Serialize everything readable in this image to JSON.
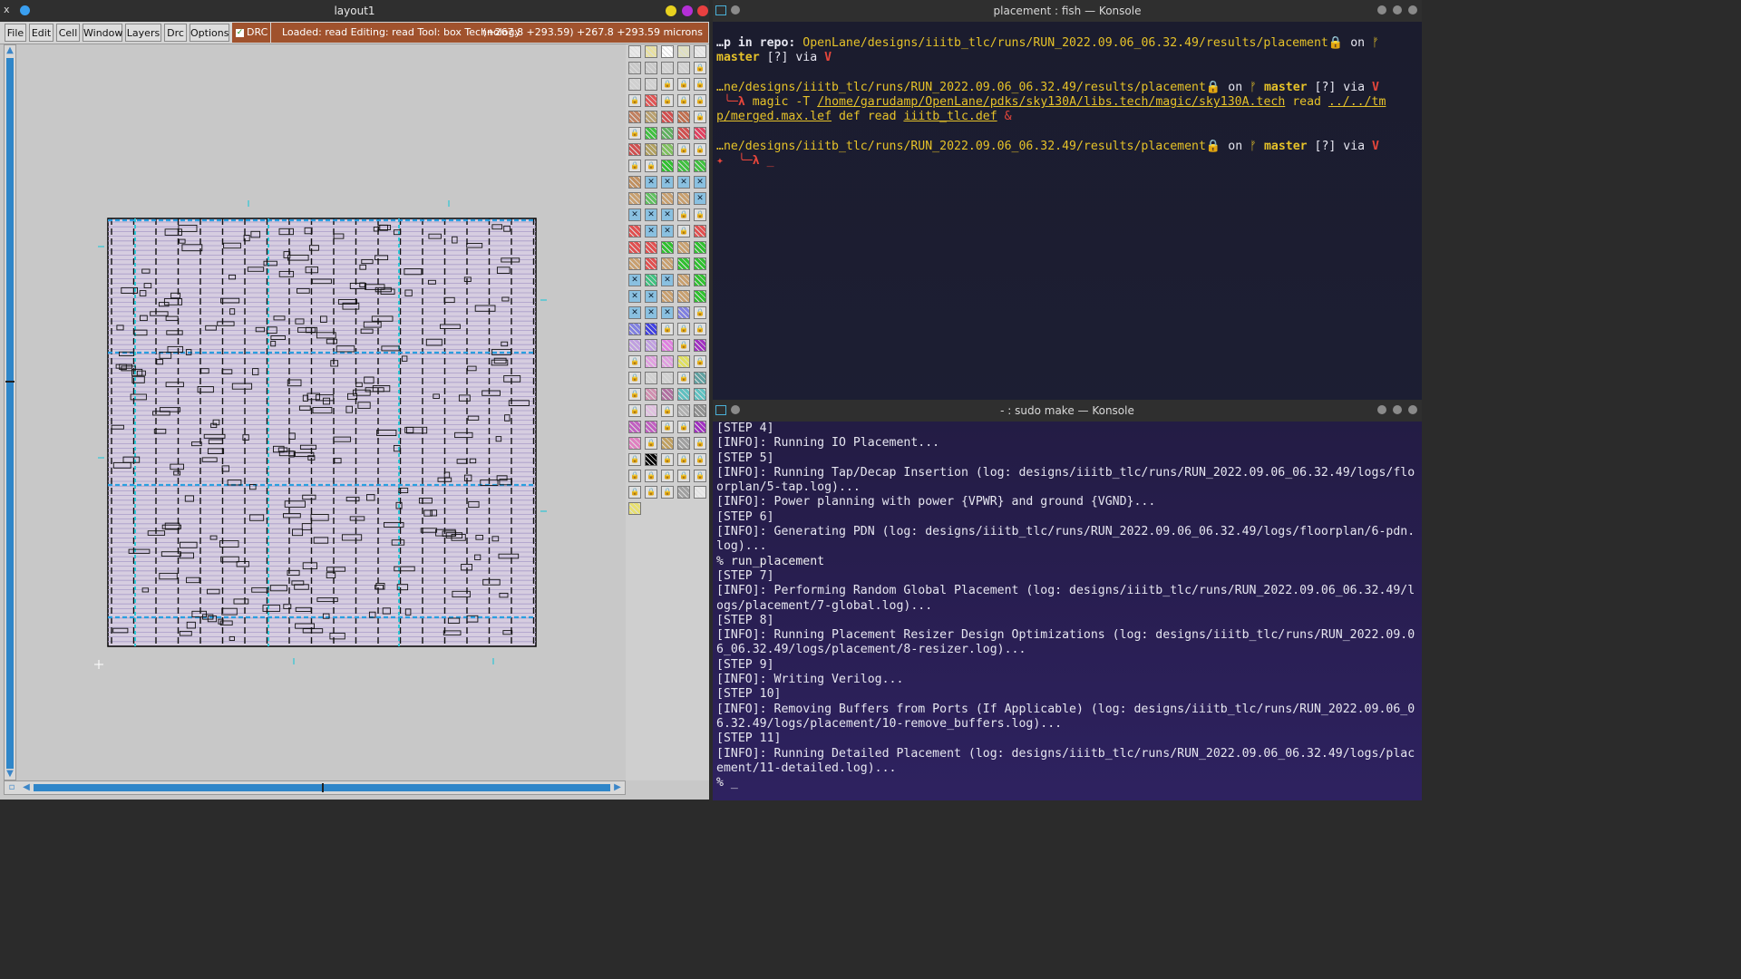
{
  "magic": {
    "title": "layout1",
    "close_glyph": "x",
    "menus": [
      "File",
      "Edit",
      "Cell",
      "Window",
      "Layers",
      "Drc",
      "Options"
    ],
    "drc_label": "DRC",
    "status": "Loaded: read Editing: read Tool: box  Technology: sky130A",
    "coords": "(+267.8 +293.59) +267.8 +293.59 microns",
    "title_dot_colors": [
      "#e8d21f",
      "#b42fd6",
      "#e84040"
    ]
  },
  "konsole_top": {
    "title": "placement : fish — Konsole",
    "lines": [
      [
        {
          "t": "…p in repo: ",
          "c": "w",
          "b": true
        },
        {
          "t": "OpenLane/designs/iiitb_tlc/runs/RUN_2022.09.06_06.32.49/results/placement",
          "c": "y"
        },
        {
          "t": "🔒 on ",
          "c": "w"
        },
        {
          "t": "ᚠ",
          "c": "y"
        }
      ],
      [
        {
          "t": "master",
          "c": "y",
          "b": true
        },
        {
          "t": " [?] via ",
          "c": "w"
        },
        {
          "t": "V",
          "c": "r",
          "b": true
        }
      ],
      [
        {
          "t": "",
          "c": "w"
        }
      ],
      [
        {
          "t": "…ne/designs/iiitb_tlc/runs/RUN_2022.09.06_06.32.49/results/placement",
          "c": "y"
        },
        {
          "t": "🔒 on ",
          "c": "w"
        },
        {
          "t": "ᚠ ",
          "c": "y"
        },
        {
          "t": "master",
          "c": "y",
          "b": true
        },
        {
          "t": " [?] via ",
          "c": "w"
        },
        {
          "t": "V",
          "c": "r",
          "b": true
        }
      ],
      [
        {
          "t": " ╰─λ ",
          "c": "r",
          "b": true
        },
        {
          "t": "magic -T ",
          "c": "y"
        },
        {
          "t": "/home/garudamp/OpenLane/pdks/sky130A/libs.tech/magic/sky130A.tech",
          "c": "y",
          "u": true
        },
        {
          "t": " read ",
          "c": "y"
        },
        {
          "t": "../../tm",
          "c": "y",
          "u": true
        }
      ],
      [
        {
          "t": "p/merged.max.lef",
          "c": "y",
          "u": true
        },
        {
          "t": " def read ",
          "c": "y"
        },
        {
          "t": "iiitb_tlc.def",
          "c": "y",
          "u": true
        },
        {
          "t": " &",
          "c": "r"
        }
      ],
      [
        {
          "t": "",
          "c": "w"
        }
      ],
      [
        {
          "t": "…ne/designs/iiitb_tlc/runs/RUN_2022.09.06_06.32.49/results/placement",
          "c": "y"
        },
        {
          "t": "🔒 on ",
          "c": "w"
        },
        {
          "t": "ᚠ ",
          "c": "y"
        },
        {
          "t": "master",
          "c": "y",
          "b": true
        },
        {
          "t": " [?] via ",
          "c": "w"
        },
        {
          "t": "V",
          "c": "r",
          "b": true
        }
      ],
      [
        {
          "t": "✦  ╰─λ ",
          "c": "r",
          "b": true
        },
        {
          "t": "_",
          "c": "r"
        }
      ]
    ]
  },
  "konsole_bottom": {
    "title": "- : sudo make — Konsole",
    "lines": [
      "[STEP 4]",
      "[INFO]: Running IO Placement...",
      "[STEP 5]",
      "[INFO]: Running Tap/Decap Insertion (log: designs/iiitb_tlc/runs/RUN_2022.09.06_06.32.49/logs/floorplan/5-tap.log)...",
      "[INFO]: Power planning with power {VPWR} and ground {VGND}...",
      "[STEP 6]",
      "[INFO]: Generating PDN (log: designs/iiitb_tlc/runs/RUN_2022.09.06_06.32.49/logs/floorplan/6-pdn.log)...",
      "% run_placement",
      "[STEP 7]",
      "[INFO]: Performing Random Global Placement (log: designs/iiitb_tlc/runs/RUN_2022.09.06_06.32.49/logs/placement/7-global.log)...",
      "[STEP 8]",
      "[INFO]: Running Placement Resizer Design Optimizations (log: designs/iiitb_tlc/runs/RUN_2022.09.06_06.32.49/logs/placement/8-resizer.log)...",
      "[STEP 9]",
      "[INFO]: Writing Verilog...",
      "[STEP 10]",
      "[INFO]: Removing Buffers from Ports (If Applicable) (log: designs/iiitb_tlc/runs/RUN_2022.09.06_06.32.49/logs/placement/10-remove_buffers.log)...",
      "[STEP 11]",
      "[INFO]: Running Detailed Placement (log: designs/iiitb_tlc/runs/RUN_2022.09.06_06.32.49/logs/placement/11-detailed.log)...",
      "% _"
    ]
  },
  "palette_rows": [
    [
      "#e8e8e8",
      "#e8e0a0",
      "#ffffff",
      "#e0e0c0",
      "#e8e8e8"
    ],
    [
      "#c8c8c8",
      "#c8c8c8",
      "#d0d0d0",
      "#d0d0d0",
      "lock"
    ],
    [
      "#d0d0d0",
      "#d0d0d0",
      "lock",
      "lock",
      "lock"
    ],
    [
      "lock",
      "#e05555",
      "lock",
      "lock",
      "lock"
    ],
    [
      "#c08060",
      "#b8a070",
      "#d05050",
      "#c07050",
      "lock"
    ],
    [
      "lock",
      "#40c040",
      "#60b060",
      "#d05050",
      "#e04060"
    ],
    [
      "#d05050",
      "#b0a060",
      "#80c060",
      "lock",
      "lock"
    ],
    [
      "lock",
      "lock",
      "#30c030",
      "#40c040",
      "#40c040"
    ],
    [
      "#c09060",
      "x",
      "x",
      "x",
      "x"
    ],
    [
      "#c8a070",
      "#60c060",
      "#c8a070",
      "#c8a070",
      "x"
    ],
    [
      "x",
      "x",
      "x",
      "lock",
      "lock"
    ],
    [
      "#e05050",
      "x",
      "x",
      "lock",
      "#e05050"
    ],
    [
      "#e05050",
      "#e05050",
      "#30c030",
      "#c8a070",
      "#30c030"
    ],
    [
      "#c8a070",
      "#e05050",
      "#c8a070",
      "#30c030",
      "#30c030"
    ],
    [
      "x",
      "#40c080",
      "x",
      "#c8a070",
      "#30c030"
    ],
    [
      "x",
      "x",
      "#c8a070",
      "#c8a070",
      "#30c030"
    ],
    [
      "x",
      "x",
      "x",
      "#8080e0",
      "lock"
    ],
    [
      "#8080e0",
      "#4040e0",
      "lock",
      "lock",
      "lock"
    ],
    [
      "#c0a0e0",
      "#c0a0e0",
      "#e080e0",
      "lock",
      "#a030c0"
    ],
    [
      "lock",
      "#e0a0e0",
      "#e0a0e0",
      "#e0e060",
      "lock"
    ],
    [
      "lock",
      "#d0d0d0",
      "#d0d0d0",
      "lock",
      "#60a0a0"
    ],
    [
      "lock",
      "#d090b0",
      "#b070a0",
      "#60c0c0",
      "#60c0c0"
    ],
    [
      "lock",
      "#e0c0e0",
      "lock",
      "#b0b0b0",
      "#909090"
    ],
    [
      "#c060c0",
      "#c060c0",
      "lock",
      "lock",
      "#a030c0"
    ],
    [
      "#e080c0",
      "lock",
      "#c0a060",
      "#a0a0a0",
      "lock"
    ],
    [
      "lock",
      "#000000",
      "lock",
      "lock",
      "lock"
    ],
    [
      "lock",
      "lock",
      "lock",
      "lock",
      "lock"
    ],
    [
      "lock",
      "lock",
      "lock",
      "#a0a0a0",
      "#e8e8e8"
    ],
    [
      "#e8e070"
    ]
  ]
}
